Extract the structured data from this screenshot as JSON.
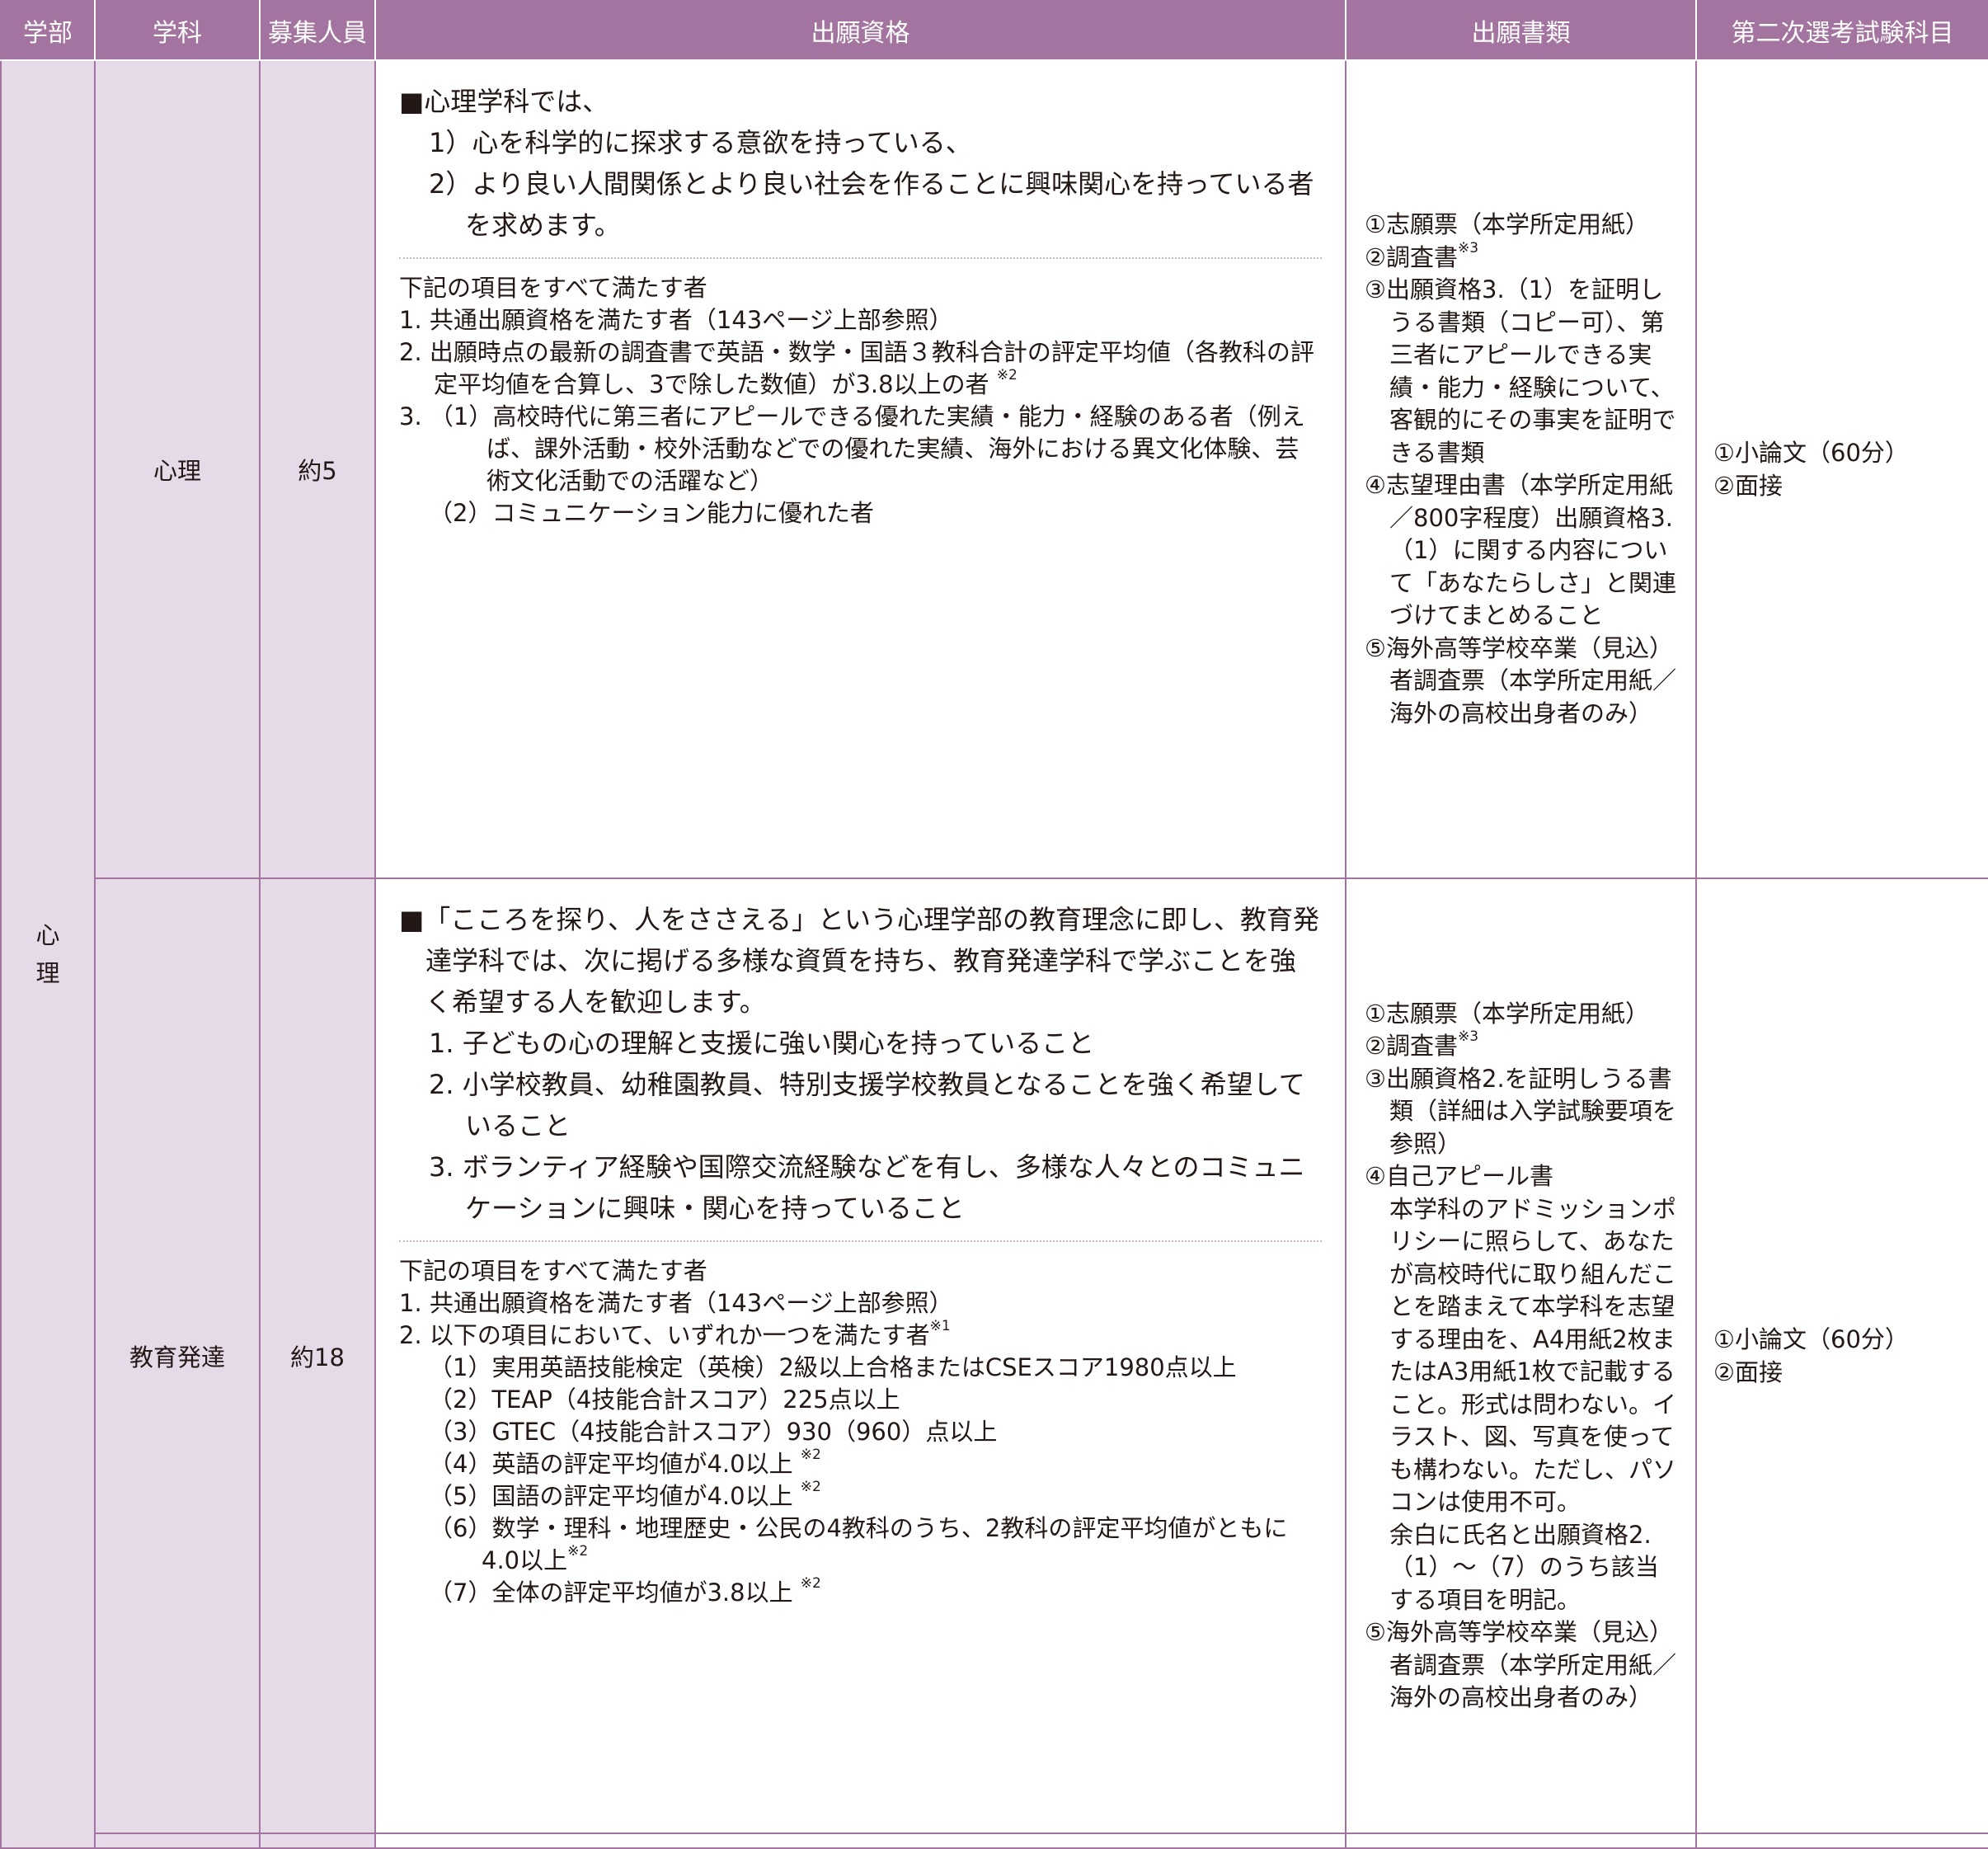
{
  "header": {
    "faculty": "学部",
    "department": "学科",
    "capacity": "募集人員",
    "qualification": "出願資格",
    "documents": "出願書類",
    "exam": "第二次選考試験科目"
  },
  "faculty_name": "心理",
  "rows": [
    {
      "department": "心理",
      "capacity": "約5",
      "policy_head": "■心理学科では、",
      "policy_items": [
        "1）心を科学的に探求する意欲を持っている、",
        "2）より良い人間関係とより良い社会を作ることに興味関心を持っている者を求めます。"
      ],
      "req_head": "下記の項目をすべて満たす者",
      "req_items": [
        "1. 共通出願資格を満たす者（143ページ上部参照）",
        "2. 出願時点の最新の調査書で英語・数学・国語３教科合計の評定平均値（各教科の評定平均値を合算し、3で除した数値）が3.8以上の者"
      ],
      "req_item2_note": "※2",
      "req_item3": "3. （1）高校時代に第三者にアピールできる優れた実績・能力・経験のある者（例えば、課外活動・校外活動などでの優れた実績、海外における異文化体験、芸術文化活動での活躍など）",
      "req_item3_sub": "（2）コミュニケーション能力に優れた者",
      "docs": [
        "①志願票（本学所定用紙）",
        "②調査書",
        "③出願資格3.（1）を証明しうる書類（コピー可）、第三者にアピールできる実績・能力・経験について、客観的にその事実を証明できる書類",
        "④志望理由書（本学所定用紙／800字程度）出願資格3.（1）に関する内容について「あなたらしさ」と関連づけてまとめること",
        "⑤海外高等学校卒業（見込）者調査票（本学所定用紙／海外の高校出身者のみ）"
      ],
      "docs_note": "※3",
      "exam": [
        "①小論文（60分）",
        "②面接"
      ]
    },
    {
      "department": "教育発達",
      "capacity": "約18",
      "policy_head": "■「こころを探り、人をささえる」という心理学部の教育理念に即し、教育発達学科では、次に掲げる多様な資質を持ち、教育発達学科で学ぶことを強く希望する人を歓迎します。",
      "policy_items": [
        "1. 子どもの心の理解と支援に強い関心を持っていること",
        "2. 小学校教員、幼稚園教員、特別支援学校教員となることを強く希望していること",
        "3. ボランティア経験や国際交流経験などを有し、多様な人々とのコミュニケーションに興味・関心を持っていること"
      ],
      "req_head": "下記の項目をすべて満たす者",
      "req_item1": "1. 共通出願資格を満たす者（143ページ上部参照）",
      "req_item2": "2. 以下の項目において、いずれか一つを満たす者",
      "req_item2_note": "※1",
      "req_subs": [
        {
          "text": "（1）実用英語技能検定（英検）2級以上合格またはCSEスコア1980点以上",
          "note": ""
        },
        {
          "text": "（2）TEAP（4技能合計スコア）225点以上",
          "note": ""
        },
        {
          "text": "（3）GTEC（4技能合計スコア）930（960）点以上",
          "note": ""
        },
        {
          "text": "（4）英語の評定平均値が4.0以上",
          "note": "※2"
        },
        {
          "text": "（5）国語の評定平均値が4.0以上",
          "note": "※2"
        },
        {
          "text": "（6）数学・理科・地理歴史・公民の4教科のうち、2教科の評定平均値がともに4.0以上",
          "note": "※2"
        },
        {
          "text": "（7）全体の評定平均値が3.8以上",
          "note": "※2"
        }
      ],
      "docs_1": "①志願票（本学所定用紙）",
      "docs_2": "②調査書",
      "docs_note": "※3",
      "docs_3": "③出願資格2.を証明しうる書類（詳細は入学試験要項を参照）",
      "docs_4": "④自己アピール書",
      "docs_4_p1": "本学科のアドミッションポリシーに照らして、あなたが高校時代に取り組んだことを踏まえて本学科を志望する理由を、A4用紙2枚またはA3用紙1枚で記載すること。形式は問わない。イラスト、図、写真を使っても構わない。ただし、パソコンは使用不可。",
      "docs_4_p2": "余白に氏名と出願資格2.（1）〜（7）のうち該当する項目を明記。",
      "docs_5": "⑤海外高等学校卒業（見込）者調査票（本学所定用紙／海外の高校出身者のみ）",
      "exam": [
        "①小論文（60分）",
        "②面接"
      ]
    }
  ],
  "colors": {
    "accent": "#a3749f",
    "lavender": "#e6d9e8",
    "text": "#231815"
  }
}
